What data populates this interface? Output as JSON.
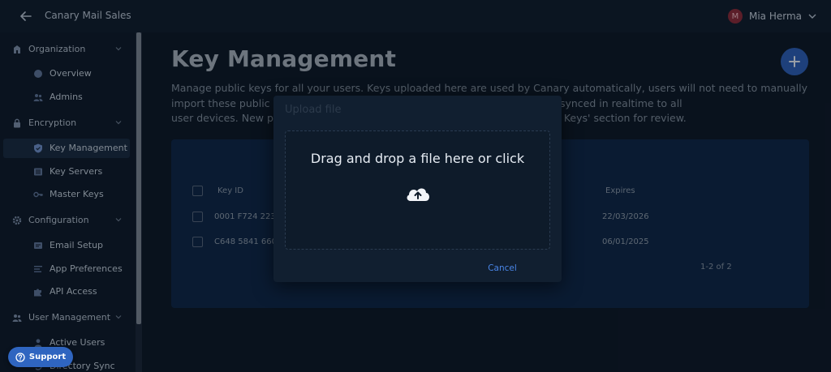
{
  "header": {
    "app_title": "Canary Mail Sales",
    "user_initial": "M",
    "user_name": "Mia Herma",
    "avatar_color": "#8a2a38"
  },
  "sidebar": {
    "sections": [
      {
        "label": "Organization",
        "icon": "building-icon",
        "items": [
          {
            "label": "Overview",
            "icon": "globe-icon"
          },
          {
            "label": "Admins",
            "icon": "people-icon"
          }
        ]
      },
      {
        "label": "Encryption",
        "icon": "lock-icon",
        "items": [
          {
            "label": "Key Management",
            "icon": "shield-check-icon",
            "active": true
          },
          {
            "label": "Key Servers",
            "icon": "server-list-icon"
          },
          {
            "label": "Master Keys",
            "icon": "key-icon"
          }
        ]
      },
      {
        "label": "Configuration",
        "icon": "gear-icon",
        "items": [
          {
            "label": "Email Setup",
            "icon": "mail-setup-icon"
          },
          {
            "label": "App Preferences",
            "icon": "preferences-icon"
          },
          {
            "label": "API Access",
            "icon": "puzzle-icon"
          }
        ]
      },
      {
        "label": "User Management",
        "icon": "people-icon",
        "items": [
          {
            "label": "Active Users",
            "icon": "user-icon"
          },
          {
            "label": "Directory Sync",
            "icon": "sync-icon"
          }
        ]
      }
    ]
  },
  "main": {
    "title": "Key Management",
    "description": "Manage public keys for all your users. Keys uploaded here are used by Canary automatically, users will not need to manually import these public keys whe",
    "description_tail_1": "f you delete a key) are synced in realtime to all",
    "description_line3_start": "user devices. New pu",
    "description_line3_end": "Keys' section for review.",
    "table": {
      "columns": {
        "key_id": "Key ID",
        "expires": "Expires"
      },
      "rows": [
        {
          "key_id": "0001 F724 223",
          "expires": "22/03/2026"
        },
        {
          "key_id": "C648 5841 660",
          "expires": "06/01/2025"
        }
      ],
      "pagination": "1-2 of 2"
    }
  },
  "dialog": {
    "title": "Upload file",
    "drop_text": "Drag and drop a file here or click",
    "cancel_label": "Cancel"
  },
  "support": {
    "label": "Support"
  },
  "colors": {
    "accent": "#2d5fb6",
    "link": "#4a86e8",
    "background": "#0d1826"
  }
}
